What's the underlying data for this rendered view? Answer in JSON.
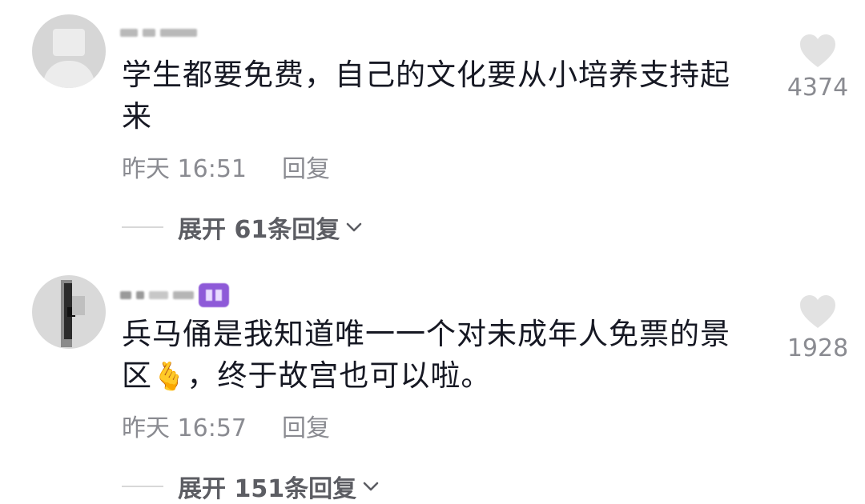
{
  "comments": [
    {
      "text": "学生都要免费，自己的文化要从小培养支持起来",
      "time": "昨天 16:51",
      "reply_label": "回复",
      "expand_label": "展开 61条回复",
      "likes": "4374"
    },
    {
      "text_before": "兵马俑是我知道唯一一个对未成年人免票的景区",
      "emoji": "🫰",
      "text_after": "，终于故宫也可以啦。",
      "time": "昨天 16:57",
      "reply_label": "回复",
      "expand_label": "展开 151条回复",
      "likes": "1928"
    }
  ],
  "icons": {
    "like": "heart-icon",
    "expand": "chevron-down-icon",
    "emoji": "finger-heart-emoji"
  },
  "colors": {
    "text": "#161823",
    "secondary": "#8a8b91",
    "heart": "#e2e2e2",
    "badge": "#8e5ad8"
  }
}
